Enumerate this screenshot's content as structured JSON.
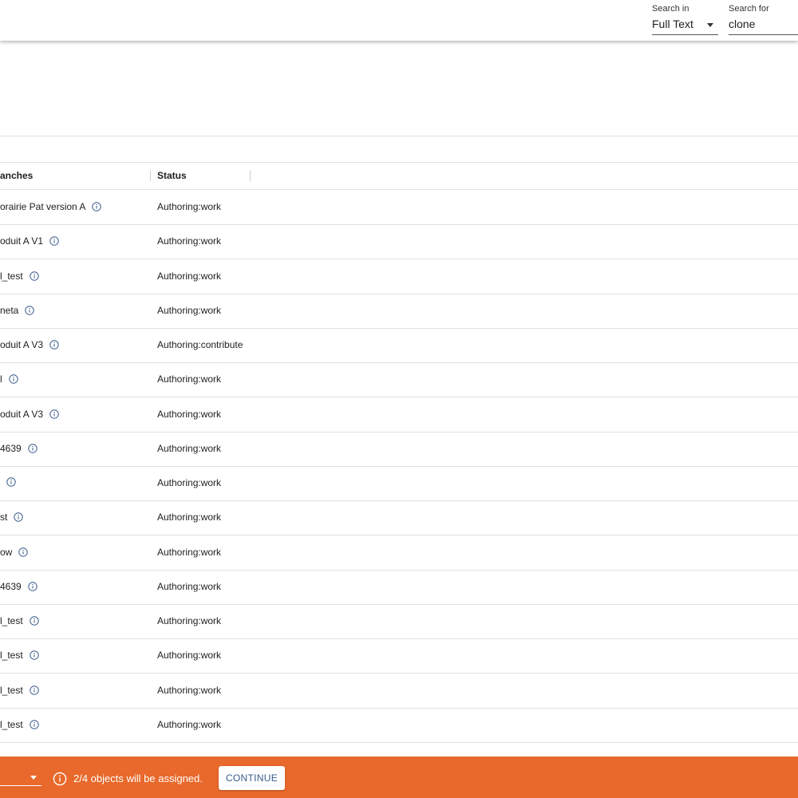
{
  "search": {
    "search_in_label": "Search in",
    "search_in_value": "Full Text",
    "search_for_label": "Search for",
    "search_for_value": "clone"
  },
  "table": {
    "columns": {
      "branches": "anches",
      "status": "Status"
    },
    "rows": [
      {
        "name": "orairie Pat version A",
        "status": "Authoring:work"
      },
      {
        "name": "oduit A V1",
        "status": "Authoring:work"
      },
      {
        "name": "l_test",
        "status": "Authoring:work"
      },
      {
        "name": "neta",
        "status": "Authoring:work"
      },
      {
        "name": "oduit A V3",
        "status": "Authoring:contribute"
      },
      {
        "name": "l",
        "status": "Authoring:work"
      },
      {
        "name": "oduit A V3",
        "status": "Authoring:work"
      },
      {
        "name": "4639",
        "status": "Authoring:work"
      },
      {
        "name": "",
        "status": "Authoring:work"
      },
      {
        "name": "st",
        "status": "Authoring:work"
      },
      {
        "name": "ow",
        "status": "Authoring:work"
      },
      {
        "name": "4639",
        "status": "Authoring:work"
      },
      {
        "name": "l_test",
        "status": "Authoring:work"
      },
      {
        "name": "l_test",
        "status": "Authoring:work"
      },
      {
        "name": "l_test",
        "status": "Authoring:work"
      },
      {
        "name": "l_test",
        "status": "Authoring:work"
      }
    ]
  },
  "footer": {
    "message": "2/4 objects will be assigned.",
    "continue_label": "CONTINUE"
  },
  "colors": {
    "accent": "#e8692b",
    "icon": "#3a5a8c"
  }
}
